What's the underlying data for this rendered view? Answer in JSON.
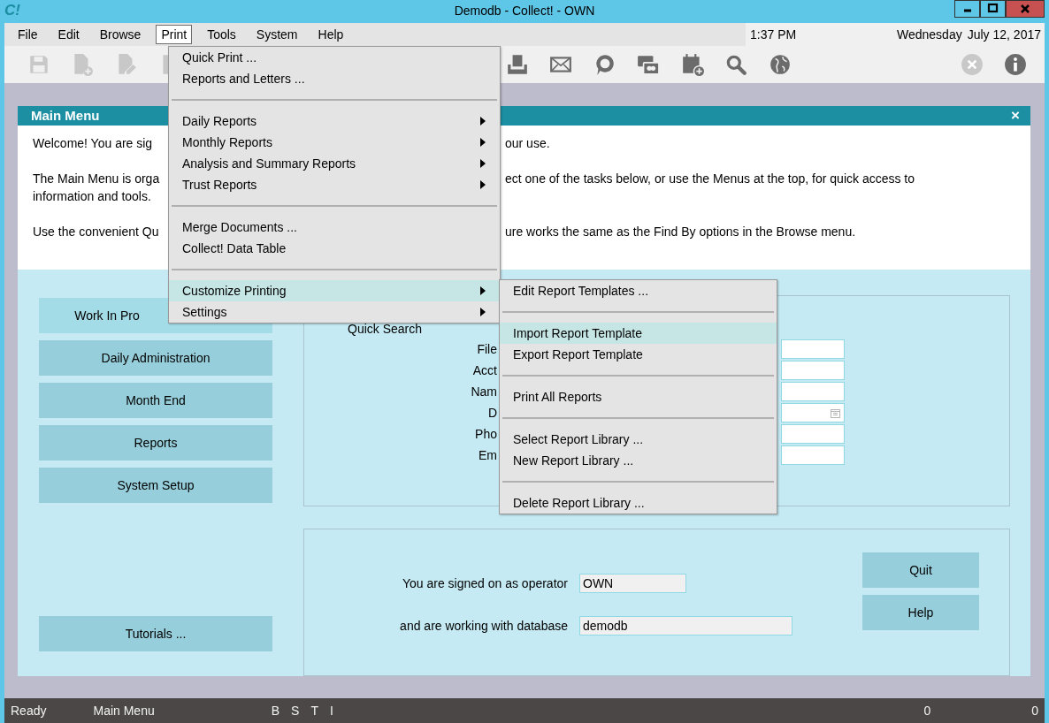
{
  "window": {
    "app_logo": "C!",
    "title": "Demodb - Collect! - OWN"
  },
  "menu_bar": {
    "items": [
      {
        "label": "File",
        "selected": false
      },
      {
        "label": "Edit",
        "selected": false
      },
      {
        "label": "Browse",
        "selected": false
      },
      {
        "label": "Print",
        "selected": true
      },
      {
        "label": "Tools",
        "selected": false
      },
      {
        "label": "System",
        "selected": false
      },
      {
        "label": "Help",
        "selected": false
      }
    ],
    "time": "1:37 PM",
    "day": "Wednesday",
    "date": "July 12, 2017"
  },
  "toolbar": {
    "left": [
      {
        "kind": "save",
        "disabled": true
      },
      {
        "kind": "new-document",
        "disabled": true
      },
      {
        "kind": "edit-document",
        "disabled": true
      },
      {
        "kind": "document",
        "disabled": true
      }
    ],
    "middle": [
      {
        "kind": "tray",
        "disabled": false
      },
      {
        "kind": "mail",
        "disabled": false
      },
      {
        "kind": "chat",
        "disabled": false
      },
      {
        "kind": "card",
        "disabled": false
      },
      {
        "kind": "calendar",
        "disabled": false
      },
      {
        "kind": "search",
        "disabled": false
      },
      {
        "kind": "globe",
        "disabled": false
      }
    ],
    "right": [
      {
        "kind": "close",
        "disabled": true
      },
      {
        "kind": "info",
        "disabled": false
      }
    ]
  },
  "main_menu": {
    "title": "Main Menu",
    "close": "×",
    "intro": [
      [
        {
          "left": "Welcome! You are sig",
          "right": "our use."
        }
      ],
      [
        {
          "left": "The Main Menu is orga",
          "right": "ect one of the tasks below, or use the Menus at the top, for quick access to"
        },
        {
          "left": "information and tools."
        }
      ],
      [
        {
          "left": "Use the convenient Qu",
          "right": "ure works the same as the Find By options in the Browse menu."
        }
      ]
    ],
    "tasks": [
      "Work In Pro",
      "Daily Administration",
      "Month End",
      "Reports",
      "System Setup"
    ],
    "tutorials": "Tutorials ...",
    "quick_search": {
      "title": "Quick Search",
      "fields": [
        {
          "label": "File",
          "kind": "text"
        },
        {
          "label": "Acct",
          "kind": "text"
        },
        {
          "label": "Nam",
          "kind": "text"
        },
        {
          "label": "D",
          "kind": "date"
        },
        {
          "label": "Pho",
          "kind": "text"
        },
        {
          "label": "Em",
          "kind": "text"
        }
      ]
    },
    "session": {
      "operator_label": "You are signed on as operator",
      "operator": "OWN",
      "database_label": "and are working with database",
      "database": "demodb",
      "buttons": [
        "Quit",
        "Help"
      ]
    }
  },
  "print_menu": {
    "groups": [
      [
        {
          "label": "Quick Print ...",
          "submenu": false,
          "selected": false
        },
        {
          "label": "Reports and Letters ...",
          "submenu": false,
          "selected": false
        }
      ],
      [
        {
          "label": "Daily Reports",
          "submenu": true,
          "selected": false
        },
        {
          "label": "Monthly Reports",
          "submenu": true,
          "selected": false
        },
        {
          "label": "Analysis and Summary Reports",
          "submenu": true,
          "selected": false
        },
        {
          "label": "Trust Reports",
          "submenu": true,
          "selected": false
        }
      ],
      [
        {
          "label": "Merge Documents ...",
          "submenu": false,
          "selected": false
        },
        {
          "label": "Collect! Data Table",
          "submenu": false,
          "selected": false
        }
      ],
      [
        {
          "label": "Customize Printing",
          "submenu": true,
          "selected": true
        },
        {
          "label": "Settings",
          "submenu": true,
          "selected": false
        }
      ]
    ]
  },
  "customize_submenu": {
    "groups": [
      [
        {
          "label": "Edit Report Templates ...",
          "selected": false
        }
      ],
      [
        {
          "label": "Import Report Template",
          "selected": true
        },
        {
          "label": "Export Report Template",
          "selected": false
        }
      ],
      [
        {
          "label": "Print All Reports",
          "selected": false
        }
      ],
      [
        {
          "label": "Select Report Library ...",
          "selected": false
        },
        {
          "label": "New Report Library ...",
          "selected": false
        }
      ],
      [
        {
          "label": "Delete Report Library ...",
          "selected": false
        }
      ]
    ]
  },
  "status_bar": {
    "state": "Ready",
    "view": "Main Menu",
    "flags": [
      "B",
      "S",
      "T",
      "I"
    ],
    "count_1": "0",
    "count_2": "0"
  }
}
